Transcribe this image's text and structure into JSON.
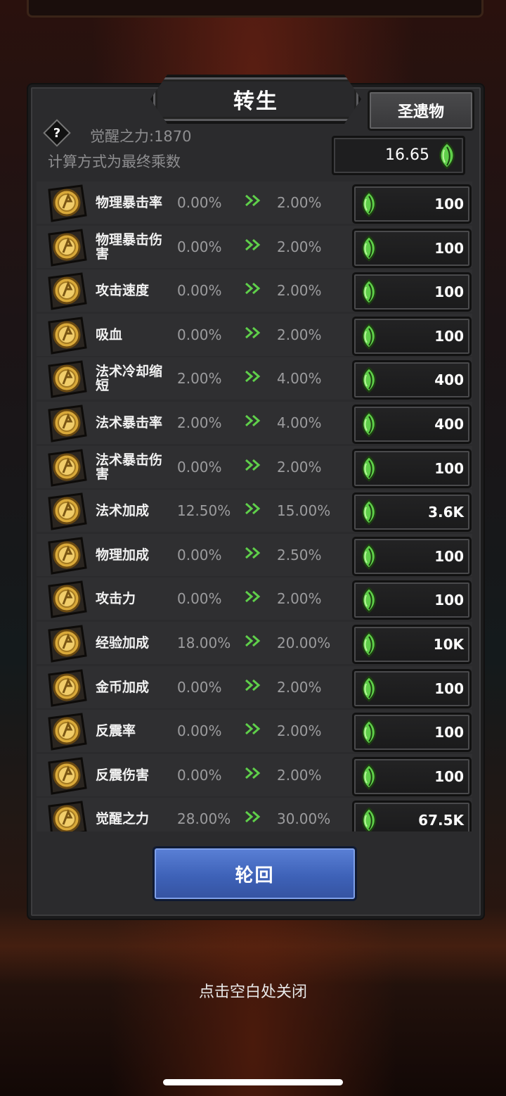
{
  "title": "转生",
  "relic_button": "圣遗物",
  "help_icon": "question-icon",
  "awaken_power": "觉醒之力:1870",
  "calc_note": "计算方式为最终乘数",
  "currency": {
    "value": "16.65",
    "icon": "green-leaf-gem-icon"
  },
  "rows": [
    {
      "name": "物理暴击率",
      "current": "0.00%",
      "next": "2.00%",
      "cost": "100"
    },
    {
      "name": "物理暴击伤害",
      "current": "0.00%",
      "next": "2.00%",
      "cost": "100"
    },
    {
      "name": "攻击速度",
      "current": "0.00%",
      "next": "2.00%",
      "cost": "100"
    },
    {
      "name": "吸血",
      "current": "0.00%",
      "next": "2.00%",
      "cost": "100"
    },
    {
      "name": "法术冷却缩短",
      "current": "2.00%",
      "next": "4.00%",
      "cost": "400"
    },
    {
      "name": "法术暴击率",
      "current": "2.00%",
      "next": "4.00%",
      "cost": "400"
    },
    {
      "name": "法术暴击伤害",
      "current": "0.00%",
      "next": "2.00%",
      "cost": "100"
    },
    {
      "name": "法术加成",
      "current": "12.50%",
      "next": "15.00%",
      "cost": "3.6K"
    },
    {
      "name": "物理加成",
      "current": "0.00%",
      "next": "2.50%",
      "cost": "100"
    },
    {
      "name": "攻击力",
      "current": "0.00%",
      "next": "2.00%",
      "cost": "100"
    },
    {
      "name": "经验加成",
      "current": "18.00%",
      "next": "20.00%",
      "cost": "10K"
    },
    {
      "name": "金币加成",
      "current": "0.00%",
      "next": "2.00%",
      "cost": "100"
    },
    {
      "name": "反震率",
      "current": "0.00%",
      "next": "2.00%",
      "cost": "100"
    },
    {
      "name": "反震伤害",
      "current": "0.00%",
      "next": "2.00%",
      "cost": "100"
    },
    {
      "name": "觉醒之力",
      "current": "28.00%",
      "next": "30.00%",
      "cost": "67.5K"
    }
  ],
  "reincarnate_button": "轮回",
  "close_hint": "点击空白处关闭",
  "colors": {
    "accent_blue": "#3e62b8",
    "leaf_green": "#5fcf4a",
    "badge_gold": "#d9a93a"
  }
}
